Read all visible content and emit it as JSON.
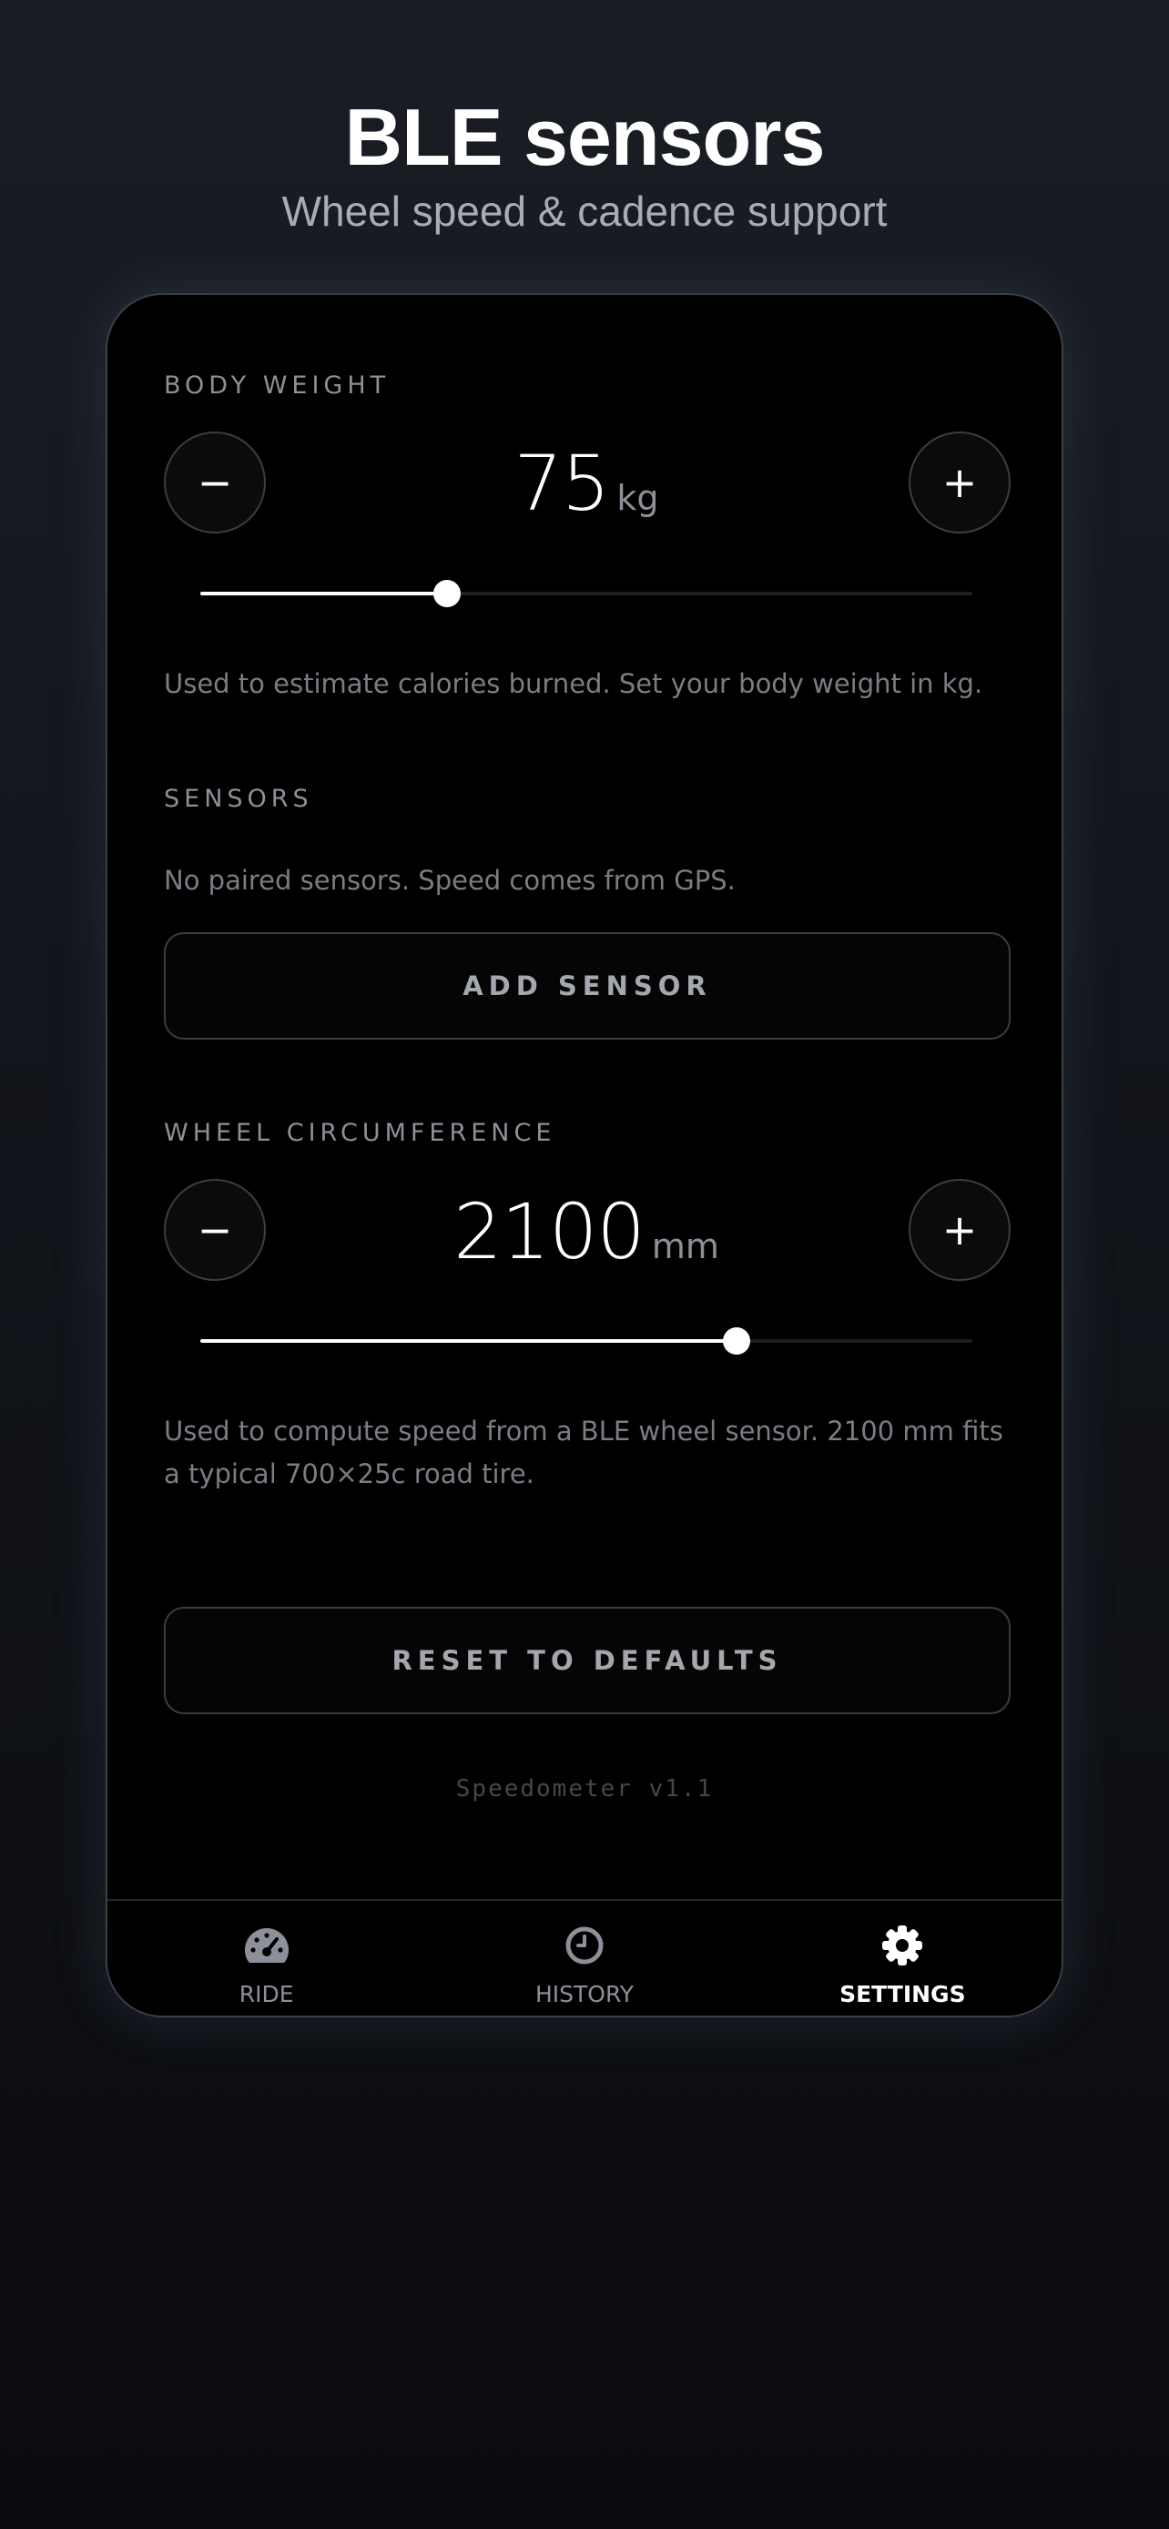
{
  "header": {
    "title": "BLE sensors",
    "subtitle": "Wheel speed & cadence support"
  },
  "body_weight": {
    "label": "BODY WEIGHT",
    "decrement_label": "−",
    "increment_label": "+",
    "value": "75",
    "unit": "kg",
    "slider_fraction": 0.32,
    "help": "Used to estimate calories burned. Set your body weight in kg."
  },
  "sensors": {
    "label": "SENSORS",
    "status": "No paired sensors. Speed comes from GPS.",
    "add_button": "ADD SENSOR"
  },
  "wheel": {
    "label": "WHEEL CIRCUMFERENCE",
    "decrement_label": "−",
    "increment_label": "+",
    "value": "2100",
    "unit": "mm",
    "slider_fraction": 0.694,
    "help": "Used to compute speed from a BLE wheel sensor. 2100 mm fits a typical 700×25c road tire."
  },
  "reset_button": "RESET TO DEFAULTS",
  "version": "Speedometer v1.1",
  "tabs": [
    {
      "label": "RIDE",
      "icon": "speedometer-icon",
      "active": false
    },
    {
      "label": "HISTORY",
      "icon": "clock-icon",
      "active": false
    },
    {
      "label": "SETTINGS",
      "icon": "gear-icon",
      "active": true
    }
  ],
  "colors": {
    "accent": "#ffffff",
    "muted": "#8d9098",
    "background": "#000000"
  }
}
